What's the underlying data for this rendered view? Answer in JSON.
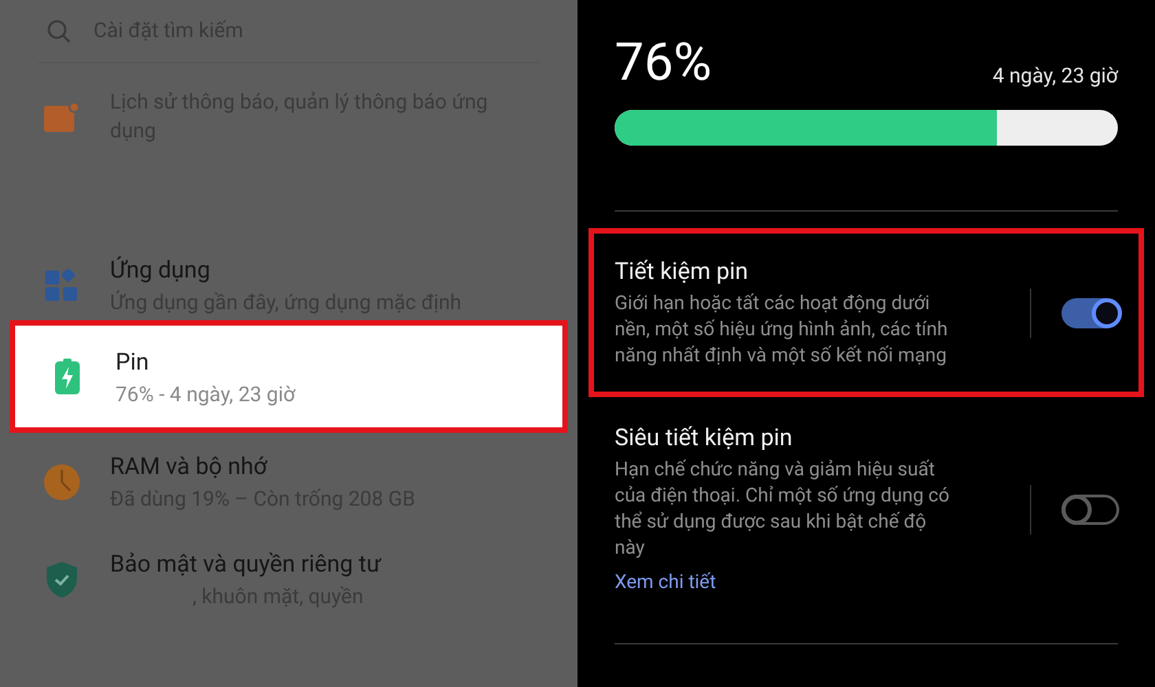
{
  "settings_list": {
    "search": {
      "placeholder": "Cài đặt tìm kiếm"
    },
    "items": [
      {
        "kind": "notifications",
        "subtitle": "Lịch sử thông báo, quản lý thông báo ứng dụng",
        "selected": false
      },
      {
        "kind": "apps",
        "title": "Ứng dụng",
        "subtitle": "Ứng dụng gần đây, ứng dụng mặc định",
        "selected": false
      },
      {
        "kind": "battery",
        "title": "Pin",
        "subtitle": "76% - 4 ngày, 23 giờ",
        "selected": true
      },
      {
        "kind": "storage",
        "title": "RAM và bộ nhớ",
        "subtitle": "Đã dùng 19% – Còn trống 208 GB",
        "selected": false
      },
      {
        "kind": "security",
        "title": "Bảo mật và quyền riêng tư",
        "subtitle": ", khuôn mặt, quyền",
        "selected": false
      }
    ]
  },
  "battery": {
    "percent": "76%",
    "remaining": "4 ngày, 23 giờ",
    "level": 0.76
  },
  "modes": [
    {
      "title": "Tiết kiệm pin",
      "description": "Giới hạn hoặc tất các hoạt động dưới nền, một số hiệu ứng hình ảnh, các tính năng nhất định và một số kết nối mạng",
      "on": true,
      "highlighted": true
    },
    {
      "title": "Siêu tiết kiệm pin",
      "description": "Hạn chế chức năng và giảm hiệu suất của điện thoại. Chỉ một số ứng dụng có thể sử dụng được sau khi bật chế độ này",
      "link": "Xem chi tiết",
      "on": false,
      "highlighted": false
    }
  ]
}
